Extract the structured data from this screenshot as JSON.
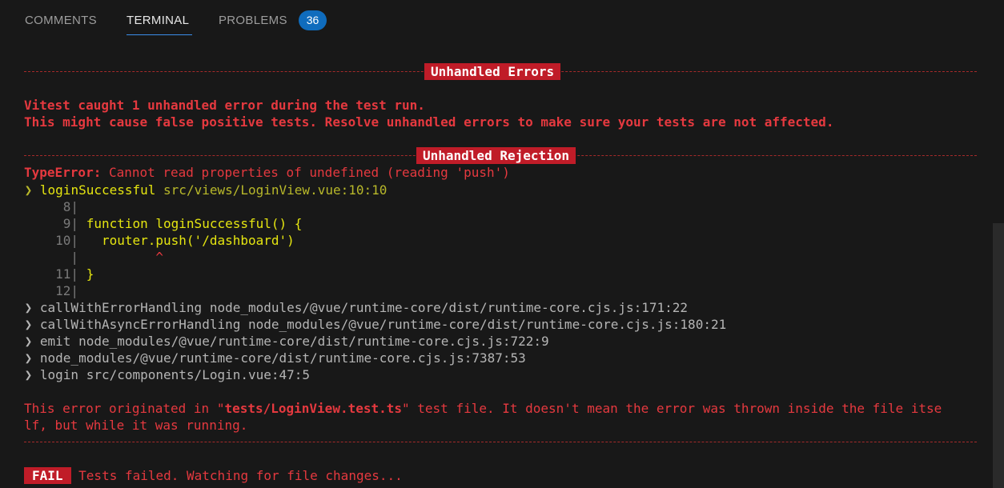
{
  "tabs": [
    {
      "label": "COMMENTS"
    },
    {
      "label": "TERMINAL"
    },
    {
      "label": "PROBLEMS"
    }
  ],
  "problems_count": "36",
  "separators": {
    "unhandled_errors": "Unhandled Errors",
    "unhandled_rejection": "Unhandled Rejection"
  },
  "summary": {
    "line1": "Vitest caught 1 unhandled error during the test run.",
    "line2": "This might cause false positive tests. Resolve unhandled errors to make sure your tests are not affected."
  },
  "error": {
    "type": "TypeError:",
    "message": " Cannot read properties of undefined (reading 'push')"
  },
  "first_frame": {
    "arrow": " ❯ ",
    "fn": "loginSuccessful",
    "location": " src/views/LoginView.vue:10:10"
  },
  "code": {
    "l8_num": "      8|",
    "l9_num": "      9|",
    "l9_code": " function loginSuccessful() {",
    "l10_num": "     10|",
    "l10_code": "   router.push('/dashboard')",
    "lc_num": "       |",
    "lc_caret": "          ^",
    "l11_num": "     11|",
    "l11_code": " }",
    "l12_num": "     12|"
  },
  "stack": [
    {
      "text": " ❯ callWithErrorHandling node_modules/@vue/runtime-core/dist/runtime-core.cjs.js:171:22"
    },
    {
      "text": " ❯ callWithAsyncErrorHandling node_modules/@vue/runtime-core/dist/runtime-core.cjs.js:180:21"
    },
    {
      "text": " ❯ emit node_modules/@vue/runtime-core/dist/runtime-core.cjs.js:722:9"
    },
    {
      "text": " ❯ node_modules/@vue/runtime-core/dist/runtime-core.cjs.js:7387:53"
    },
    {
      "text": " ❯ login src/components/Login.vue:47:5"
    }
  ],
  "origin": {
    "prefix": "This error originated in \"",
    "file": "tests/LoginView.test.ts",
    "suffix": "\" test file. It doesn't mean the error was thrown inside the file itse",
    "line2": "lf, but while it was running."
  },
  "footer": {
    "fail": "FAIL",
    "message": " Tests failed. Watching for file changes..."
  },
  "colors": {
    "background": "#181818",
    "error_red": "#e5393f",
    "label_red": "#c01c28",
    "accent_blue": "#0f6cbd",
    "code_yellow": "#e5e510"
  }
}
